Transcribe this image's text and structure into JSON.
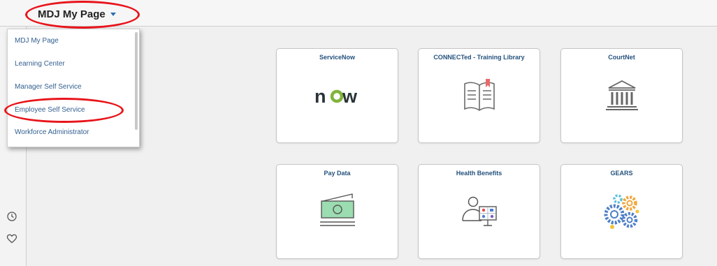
{
  "header": {
    "page_title": "MDJ My Page"
  },
  "dropdown": {
    "items": [
      {
        "label": "MDJ My Page"
      },
      {
        "label": "Learning Center"
      },
      {
        "label": "Manager Self Service"
      },
      {
        "label": "Employee Self Service"
      },
      {
        "label": "Workforce Administrator"
      }
    ]
  },
  "tiles": [
    {
      "title": "ServiceNow",
      "icon": "servicenow-logo",
      "logo_text": "now"
    },
    {
      "title": "CONNECTed - Training Library",
      "icon": "open-book-icon"
    },
    {
      "title": "CourtNet",
      "icon": "courthouse-icon"
    },
    {
      "title": "Pay Data",
      "icon": "money-icon"
    },
    {
      "title": "Health Benefits",
      "icon": "health-benefits-icon"
    },
    {
      "title": "GEARS",
      "icon": "gears-icon"
    }
  ],
  "rail": {
    "icons": [
      "clock-icon",
      "heart-icon"
    ]
  },
  "colors": {
    "annotation_red": "#e8141a",
    "link_blue": "#325f8f",
    "title_blue": "#24527d",
    "logo_green": "#81b33a"
  }
}
